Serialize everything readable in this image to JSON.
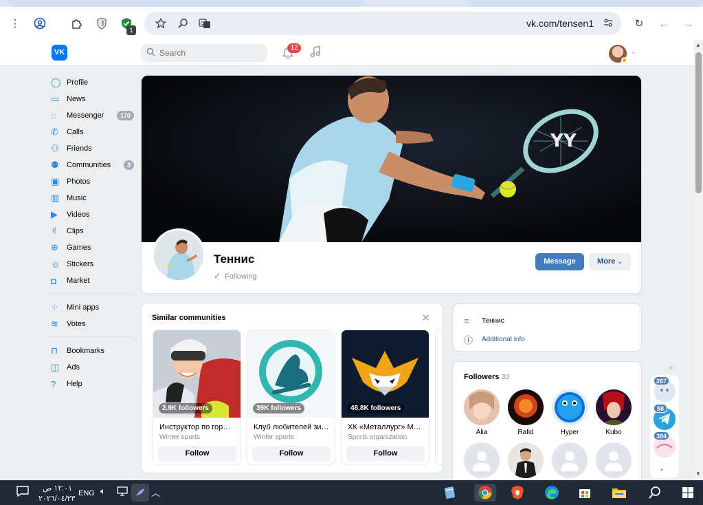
{
  "browser": {
    "url": "vk.com/tensen1",
    "extension_badge": "1",
    "icons": [
      "menu-dots-icon",
      "profile-icon",
      "extensions-icon",
      "shield-icon",
      "vpn-shield-icon",
      "star-icon",
      "zoom-icon",
      "translate-icon",
      "tune-icon",
      "reload-icon",
      "back-icon",
      "forward-icon"
    ]
  },
  "header": {
    "logo": "VK",
    "search_placeholder": "Search",
    "notifications_count": "12"
  },
  "nav": {
    "items": [
      {
        "label": "Profile",
        "icon": "profile-icon",
        "count": ""
      },
      {
        "label": "News",
        "icon": "news-icon",
        "count": ""
      },
      {
        "label": "Messenger",
        "icon": "messenger-icon",
        "count": "170"
      },
      {
        "label": "Calls",
        "icon": "phone-icon",
        "count": ""
      },
      {
        "label": "Friends",
        "icon": "friends-icon",
        "count": ""
      },
      {
        "label": "Communities",
        "icon": "communities-icon",
        "count": "3"
      },
      {
        "label": "Photos",
        "icon": "photos-icon",
        "count": ""
      },
      {
        "label": "Music",
        "icon": "music-icon",
        "count": ""
      },
      {
        "label": "Videos",
        "icon": "videos-icon",
        "count": ""
      },
      {
        "label": "Clips",
        "icon": "clips-icon",
        "count": ""
      },
      {
        "label": "Games",
        "icon": "games-icon",
        "count": ""
      },
      {
        "label": "Stickers",
        "icon": "stickers-icon",
        "count": ""
      },
      {
        "label": "Market",
        "icon": "market-icon",
        "count": ""
      }
    ],
    "items2": [
      {
        "label": "Mini apps",
        "icon": "mini-apps-icon"
      },
      {
        "label": "Votes",
        "icon": "votes-icon"
      }
    ],
    "items3": [
      {
        "label": "Bookmarks",
        "icon": "bookmarks-icon"
      },
      {
        "label": "Ads",
        "icon": "ads-icon"
      },
      {
        "label": "Help",
        "icon": "help-icon"
      }
    ]
  },
  "profile": {
    "name": "Теннис",
    "following": "Following",
    "message_button": "Message",
    "more_button": "More"
  },
  "similar": {
    "title": "Similar communities",
    "cards": [
      {
        "followers": "2.9K followers",
        "name": "Инструктор по гор…",
        "type": "Winter sports",
        "follow": "Follow"
      },
      {
        "followers": "39K followers",
        "name": "Клуб любителей зи…",
        "type": "Winter sports",
        "follow": "Follow"
      },
      {
        "followers": "48.8K followers",
        "name": "ХК «Металлург» М…",
        "type": "Sports organization",
        "follow": "Follow"
      }
    ]
  },
  "info": {
    "name": "Теннис",
    "additional": "Additional info"
  },
  "followers": {
    "title": "Followers",
    "count": "32",
    "people": [
      {
        "name": "Alia"
      },
      {
        "name": "Rafid"
      },
      {
        "name": "Hyper"
      },
      {
        "name": "Kubo"
      }
    ]
  },
  "mini_chats": [
    {
      "badge": "267"
    },
    {
      "badge": "58"
    },
    {
      "badge": "384"
    }
  ],
  "taskbar": {
    "time": "١٢:٠١ ص",
    "date": "٢٠٢٦/٠٤/٢٣",
    "lang": "ENG"
  },
  "colors": {
    "vk_blue": "#0077ff",
    "button_blue": "#447bba",
    "link_blue": "#2a5885",
    "badge_red": "#e64646"
  }
}
